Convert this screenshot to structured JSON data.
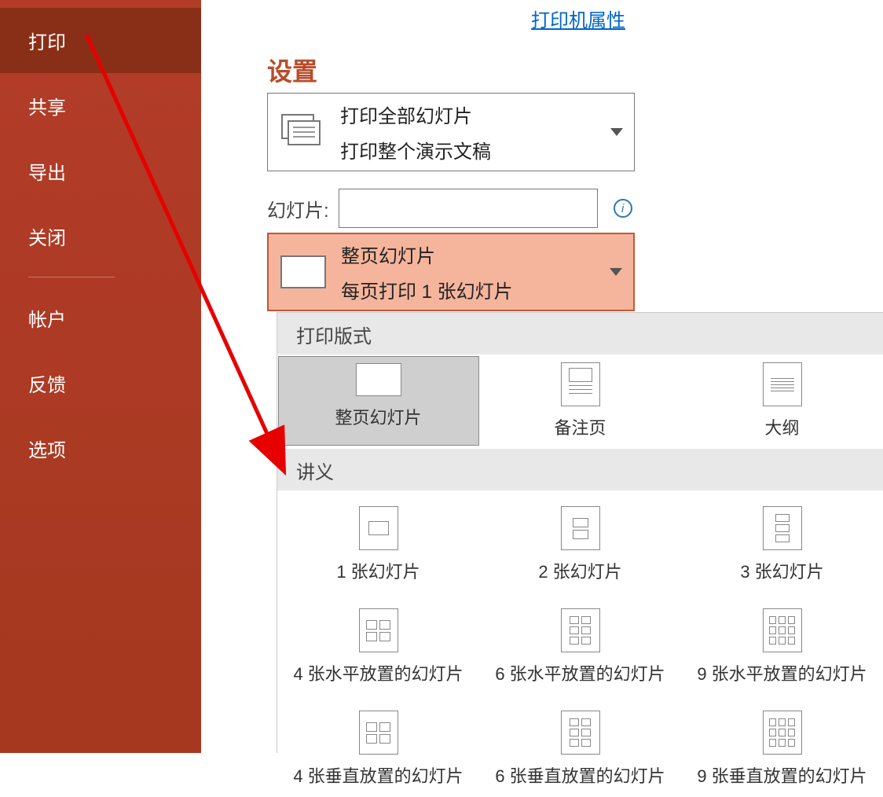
{
  "sidebar": {
    "items": [
      {
        "label": "打印",
        "active": true
      },
      {
        "label": "共享"
      },
      {
        "label": "导出"
      },
      {
        "label": "关闭"
      }
    ],
    "items_below": [
      {
        "label": "帐户"
      },
      {
        "label": "反馈"
      },
      {
        "label": "选项"
      }
    ]
  },
  "printer_link": "打印机属性",
  "settings_heading": "设置",
  "dropdown1": {
    "title": "打印全部幻灯片",
    "subtitle": "打印整个演示文稿"
  },
  "slides_label": "幻灯片:",
  "dropdown2": {
    "title": "整页幻灯片",
    "subtitle": "每页打印 1 张幻灯片"
  },
  "popup": {
    "section1_title": "打印版式",
    "layouts": [
      {
        "label": "整页幻灯片",
        "selected": true
      },
      {
        "label": "备注页"
      },
      {
        "label": "大纲"
      }
    ],
    "section2_title": "讲义",
    "handouts_row1": [
      {
        "label": "1 张幻灯片"
      },
      {
        "label": "2 张幻灯片"
      },
      {
        "label": "3 张幻灯片"
      }
    ],
    "handouts_row2": [
      {
        "label": "4 张水平放置的幻灯片"
      },
      {
        "label": "6 张水平放置的幻灯片"
      },
      {
        "label": "9 张水平放置的幻灯片"
      }
    ],
    "handouts_row3": [
      {
        "label": "4 张垂直放置的幻灯片"
      },
      {
        "label": "6 张垂直放置的幻灯片"
      },
      {
        "label": "9 张垂直放置的幻灯片"
      }
    ]
  }
}
